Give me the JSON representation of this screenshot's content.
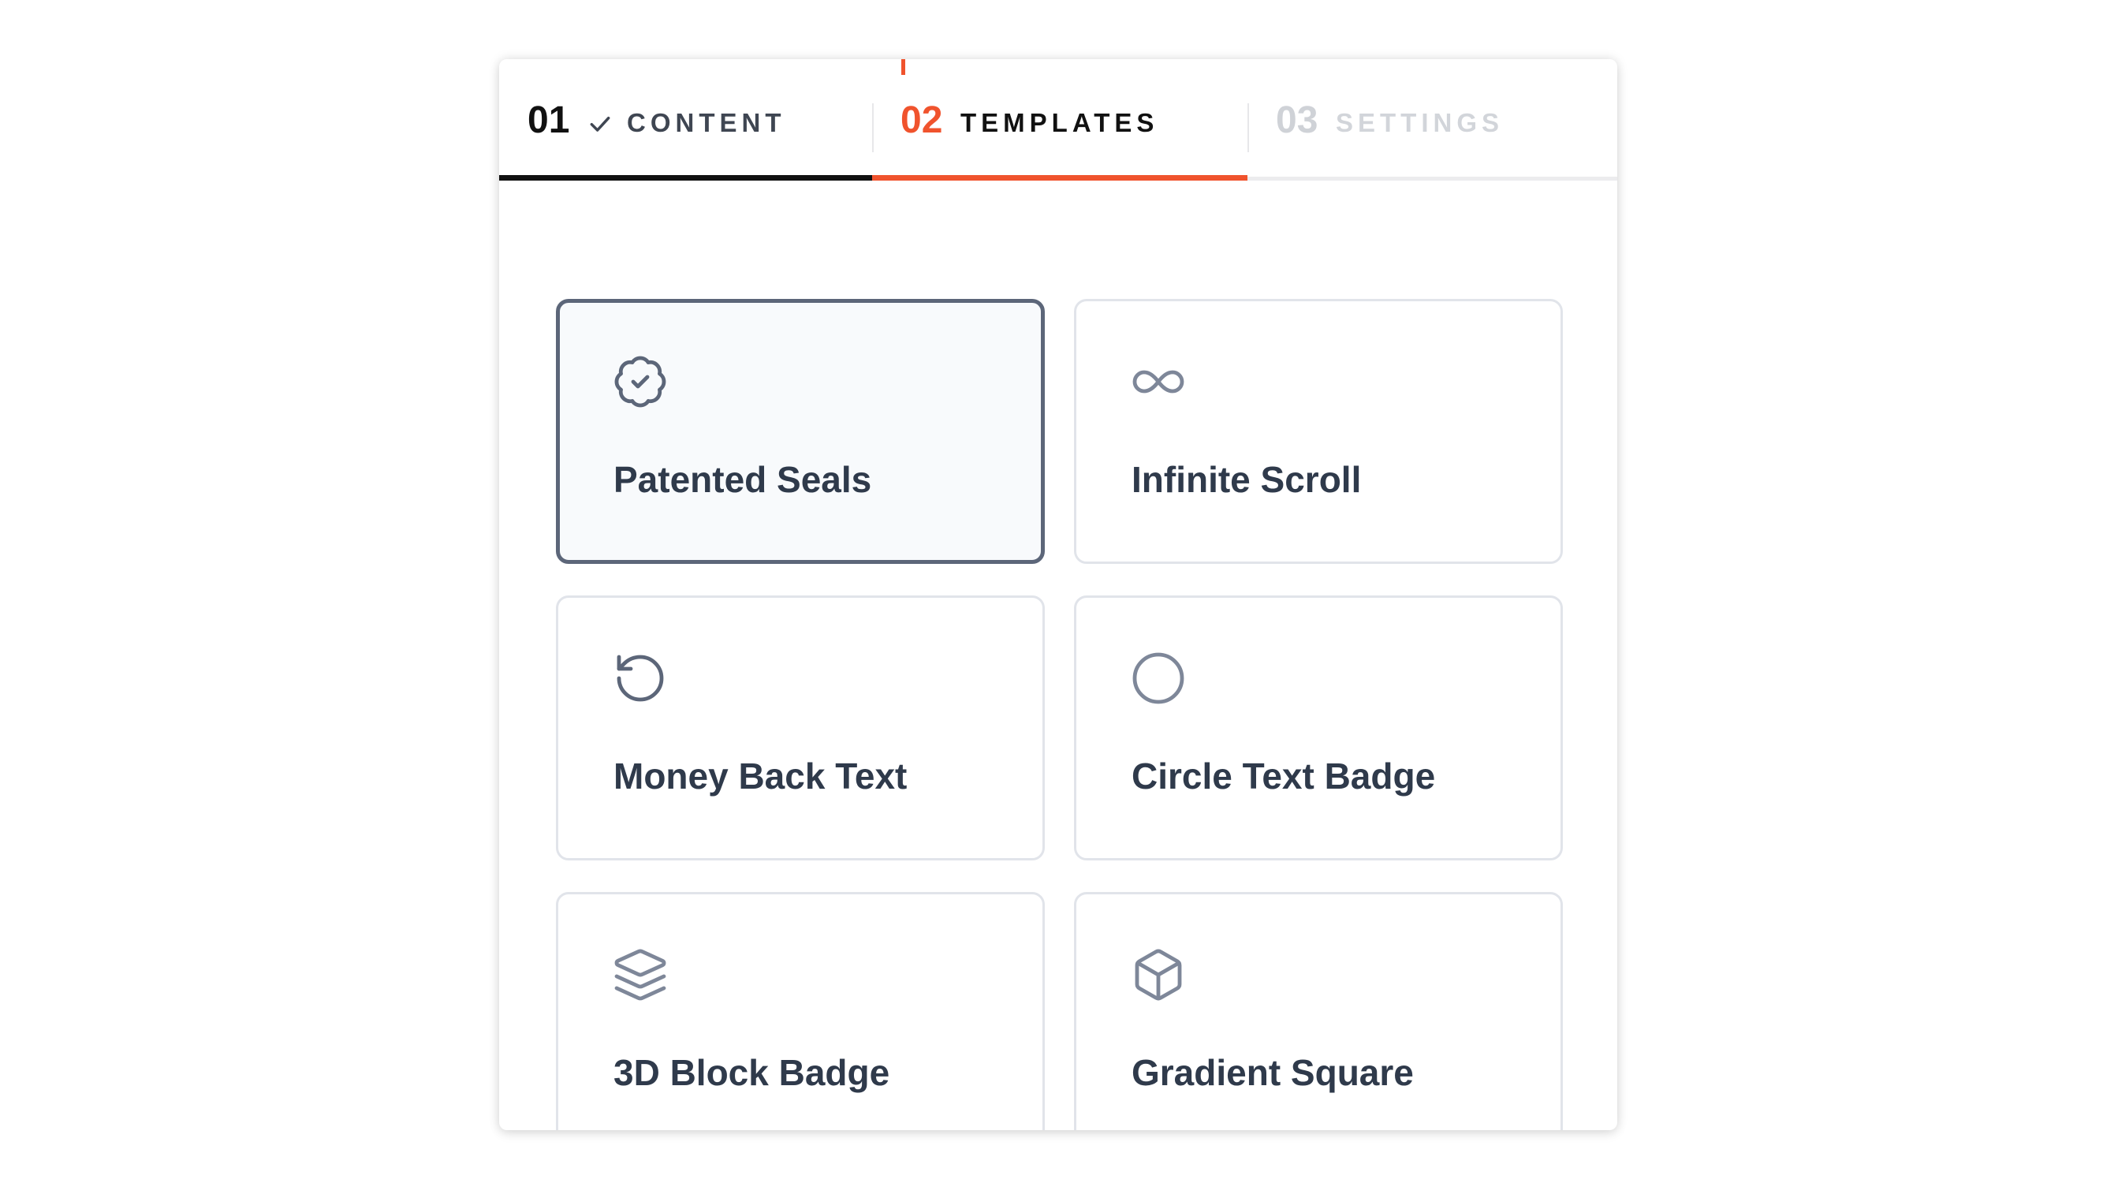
{
  "stepper": {
    "steps": [
      {
        "number": "01",
        "label": "CONTENT",
        "state": "completed"
      },
      {
        "number": "02",
        "label": "TEMPLATES",
        "state": "active"
      },
      {
        "number": "03",
        "label": "SETTINGS",
        "state": "upcoming"
      }
    ]
  },
  "templates": [
    {
      "title": "Patented Seals",
      "icon": "badge-check-icon",
      "selected": true
    },
    {
      "title": "Infinite Scroll",
      "icon": "infinity-icon",
      "selected": false
    },
    {
      "title": "Money Back Text",
      "icon": "rotate-ccw-icon",
      "selected": false
    },
    {
      "title": "Circle Text Badge",
      "icon": "circle-icon",
      "selected": false
    },
    {
      "title": "3D Block Badge",
      "icon": "layers-icon",
      "selected": false
    },
    {
      "title": "Gradient Square",
      "icon": "box-icon",
      "selected": false
    }
  ],
  "colors": {
    "accent": "#f0532d",
    "completed": "#111111",
    "muted": "#cfd2d7",
    "card_border": "#e1e4ea",
    "selected_border": "#5c6679",
    "title_text": "#2f3a4b",
    "icon_stroke": "#7e8799"
  }
}
